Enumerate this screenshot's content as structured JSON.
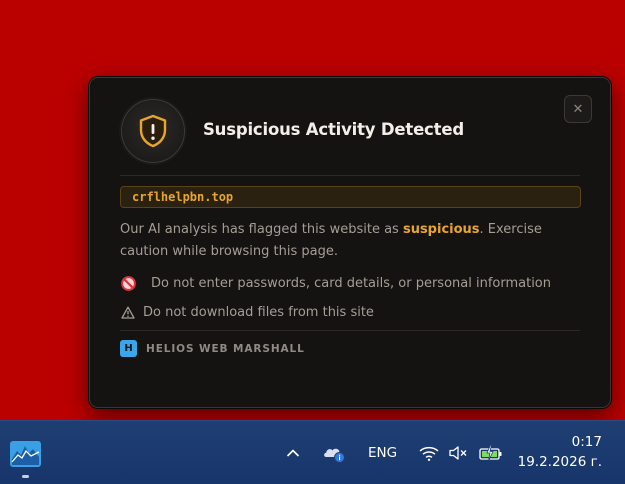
{
  "alert": {
    "title": "Suspicious Activity Detected",
    "domain": "crflhelpbn.top",
    "description_prefix": "Our AI analysis has flagged this website as ",
    "description_highlight": "suspicious",
    "description_suffix": ". Exercise caution while browsing this page.",
    "warnings": [
      {
        "icon": "no-entry-icon",
        "text": "Do not enter passwords, card details, or personal information"
      },
      {
        "icon": "warning-triangle-icon",
        "text": "Do not download files from this site"
      }
    ],
    "brand_badge": "H",
    "brand_name": "HELIOS WEB MARSHALL",
    "close_symbol": "✕"
  },
  "taskbar": {
    "language": "ENG",
    "time": "0:17",
    "date": "19.2.2026 г.",
    "tray_icons": [
      "chevron-up-icon",
      "onedrive-icon",
      "wifi-icon",
      "muted-speaker-icon",
      "battery-charging-icon"
    ]
  },
  "colors": {
    "desktop_background": "#bb0000",
    "card_background": "#141312",
    "accent_amber": "#e7a52b",
    "taskbar": "#1f3f73",
    "brand_blue": "#3aa5e8"
  }
}
